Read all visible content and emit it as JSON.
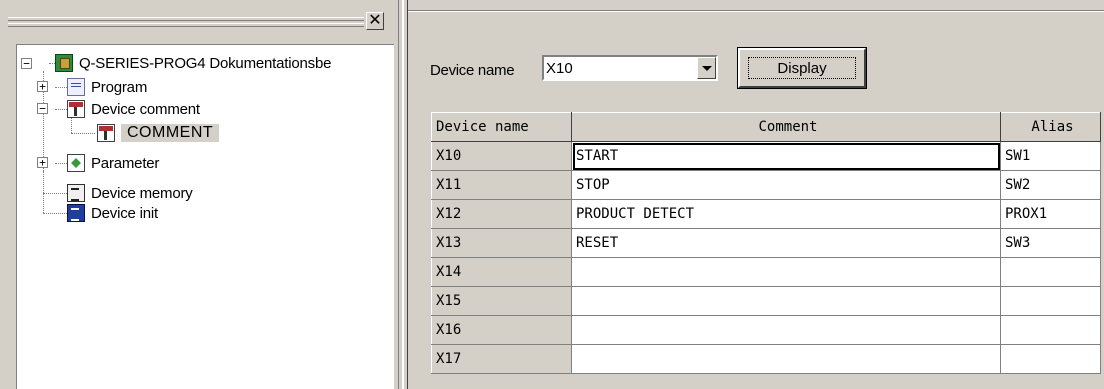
{
  "tree": {
    "root": {
      "label": "Q-SERIES-PROG4 Dokumentationsbe",
      "icon": "project-icon",
      "expander": "−"
    },
    "items": [
      {
        "label": "Program",
        "icon": "program-icon",
        "expander": "+"
      },
      {
        "label": "Device comment",
        "icon": "device-comment-icon",
        "expander": "−"
      },
      {
        "label": "COMMENT",
        "icon": "comment-icon",
        "selected": true
      },
      {
        "label": "Parameter",
        "icon": "parameter-icon",
        "expander": "+"
      },
      {
        "label": "Device memory",
        "icon": "device-memory-icon"
      },
      {
        "label": "Device init",
        "icon": "device-init-icon"
      }
    ],
    "close": "✕"
  },
  "toolbar": {
    "device_name_label": "Device name",
    "device_name_value": "X10",
    "display_label": "Display"
  },
  "table": {
    "headers": [
      "Device name",
      "Comment",
      "Alias"
    ],
    "rows": [
      {
        "device": "X10",
        "comment": "START",
        "alias": "SW1"
      },
      {
        "device": "X11",
        "comment": "STOP",
        "alias": "SW2"
      },
      {
        "device": "X12",
        "comment": "PRODUCT DETECT",
        "alias": "PROX1"
      },
      {
        "device": "X13",
        "comment": "RESET",
        "alias": "SW3"
      },
      {
        "device": "X14",
        "comment": "",
        "alias": ""
      },
      {
        "device": "X15",
        "comment": "",
        "alias": ""
      },
      {
        "device": "X16",
        "comment": "",
        "alias": ""
      },
      {
        "device": "X17",
        "comment": "",
        "alias": ""
      }
    ]
  }
}
